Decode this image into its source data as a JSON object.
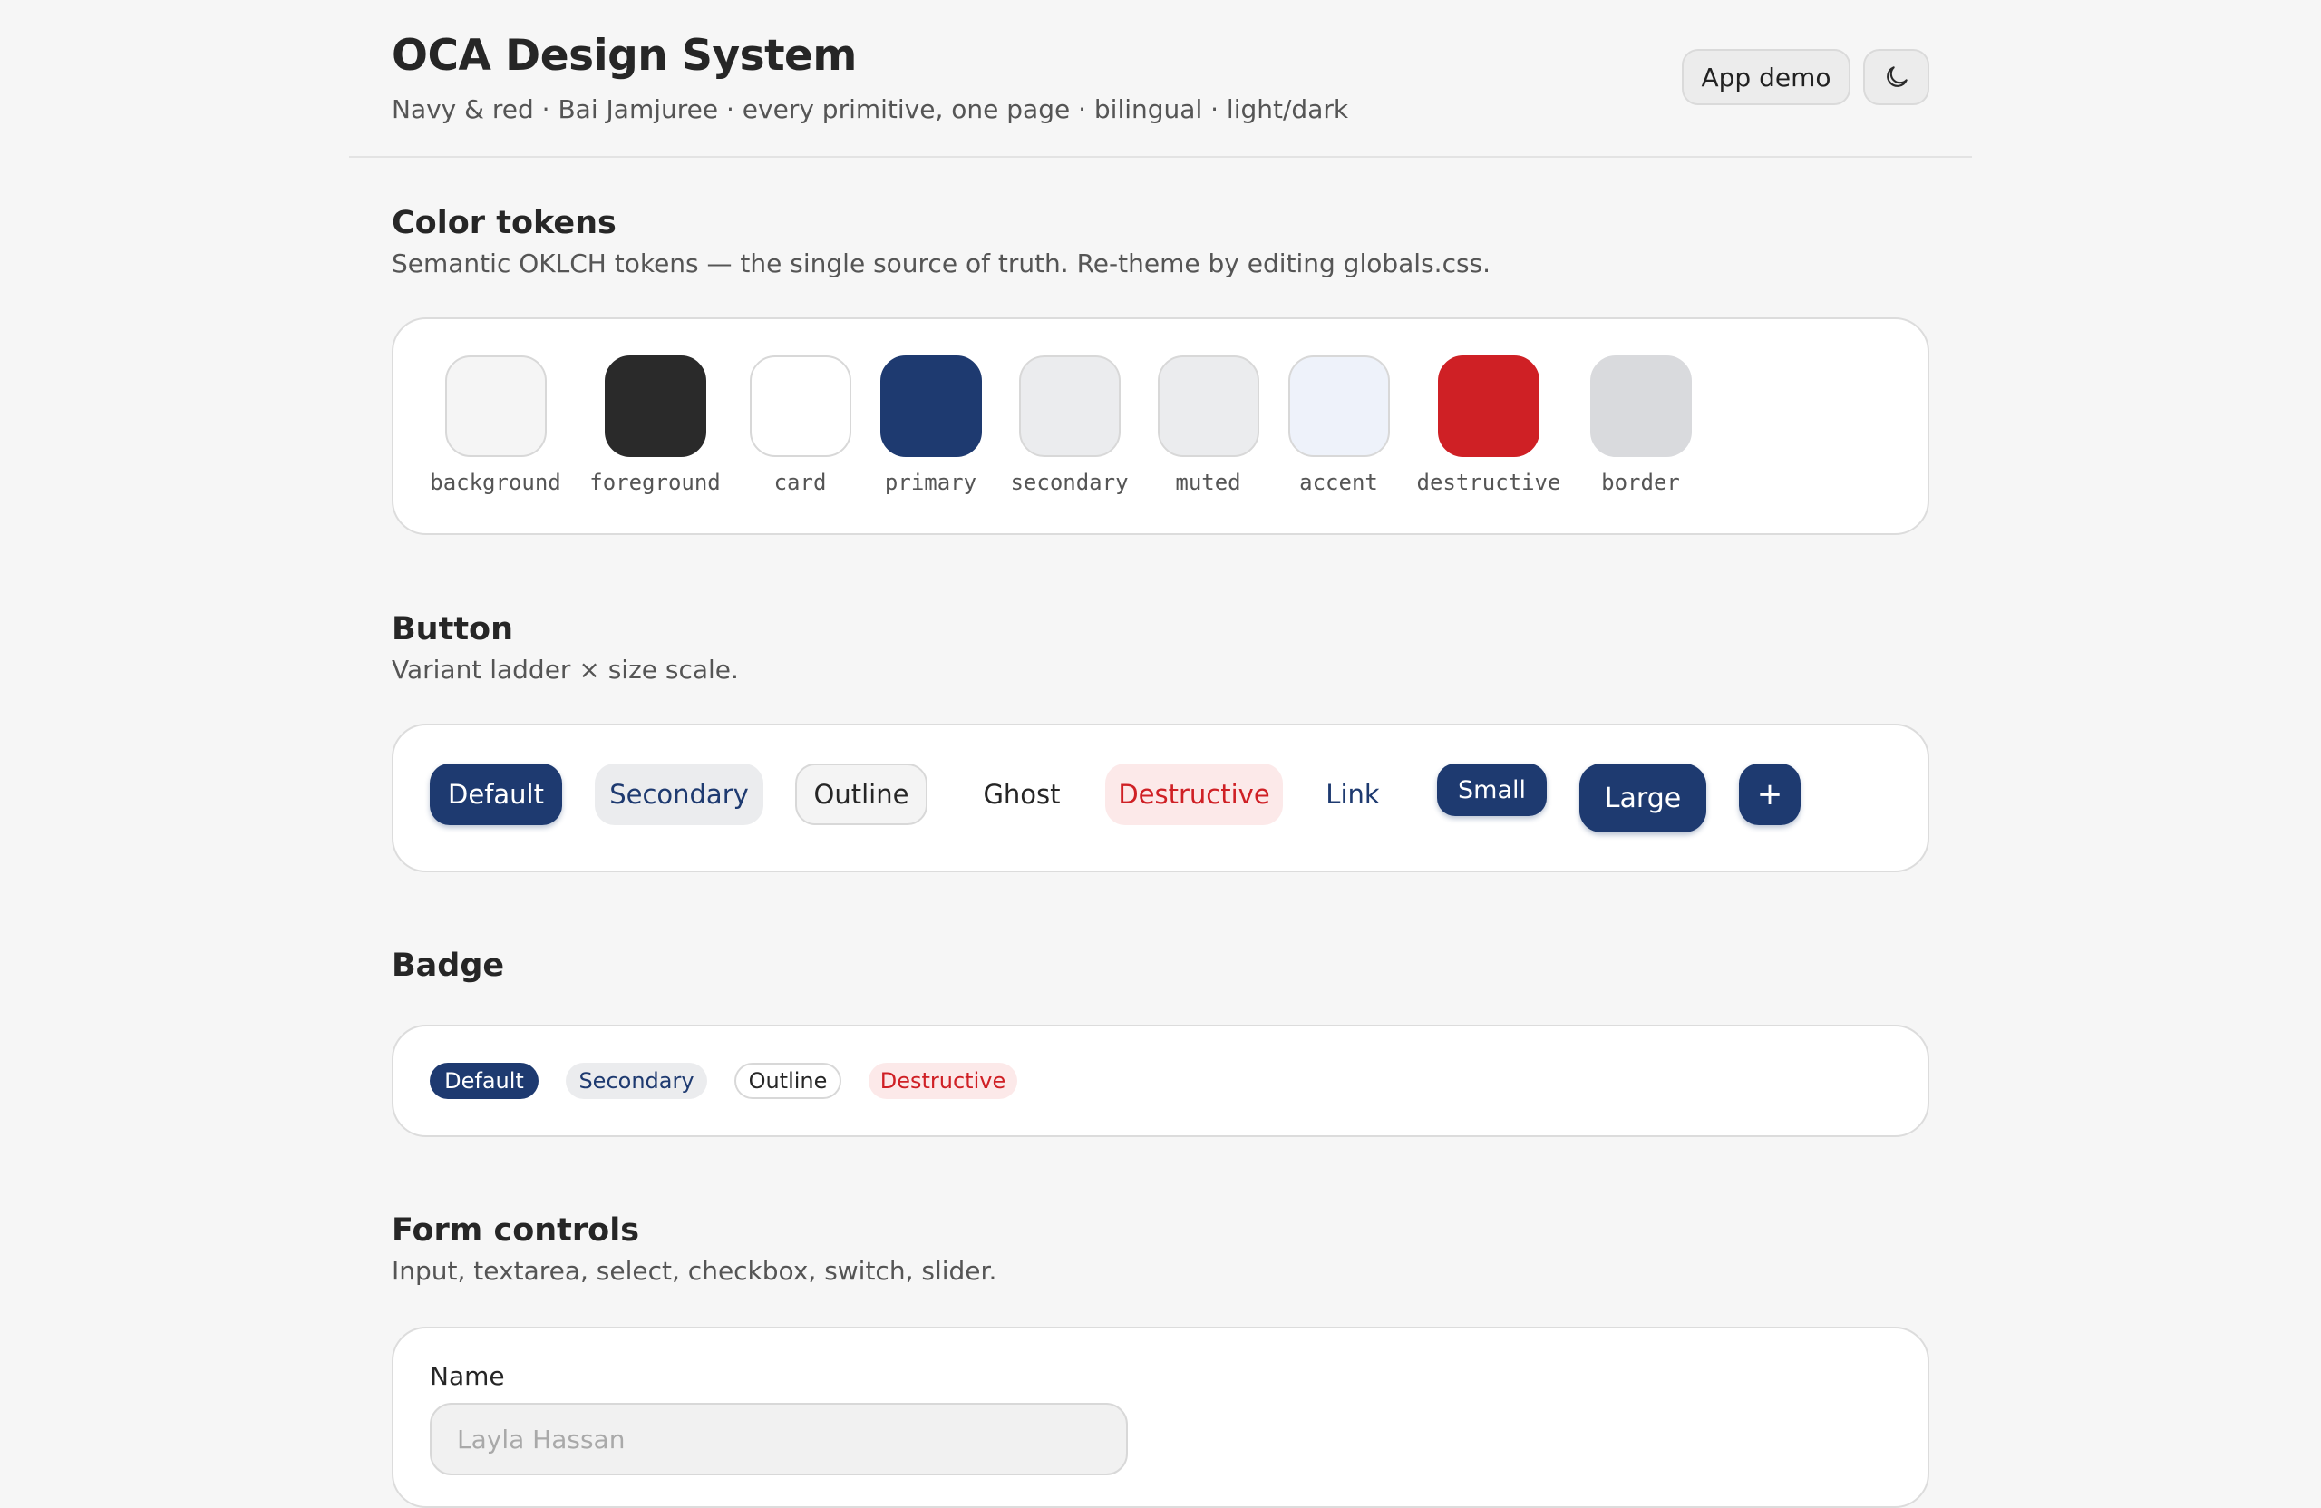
{
  "header": {
    "title": "OCA Design System",
    "subtitle": "Navy & red · Bai Jamjuree · every primitive, one page · bilingual · light/dark",
    "app_demo_label": "App demo",
    "theme_icon": "moon-icon"
  },
  "colors": {
    "primary": "#1e3a70",
    "destructive": "#cf2025",
    "foreground": "#2a2a2a",
    "background": "#f6f6f6"
  },
  "sections": {
    "color_tokens": {
      "title": "Color tokens",
      "desc": "Semantic OKLCH tokens — the single source of truth. Re-theme by editing globals.css.",
      "tokens": [
        {
          "label": "background",
          "color": "#f5f5f5"
        },
        {
          "label": "foreground",
          "color": "#2a2a2a"
        },
        {
          "label": "card",
          "color": "#ffffff"
        },
        {
          "label": "primary",
          "color": "#1e3a70"
        },
        {
          "label": "secondary",
          "color": "#ebecee"
        },
        {
          "label": "muted",
          "color": "#ebecee"
        },
        {
          "label": "accent",
          "color": "#eef2fa"
        },
        {
          "label": "destructive",
          "color": "#cf2025"
        },
        {
          "label": "border",
          "color": "#d9dadd"
        }
      ]
    },
    "button": {
      "title": "Button",
      "desc": "Variant ladder × size scale.",
      "buttons": {
        "default": "Default",
        "secondary": "Secondary",
        "outline": "Outline",
        "ghost": "Ghost",
        "destructive": "Destructive",
        "link": "Link",
        "small": "Small",
        "large": "Large",
        "icon": "+"
      }
    },
    "badge": {
      "title": "Badge",
      "badges": {
        "default": "Default",
        "secondary": "Secondary",
        "outline": "Outline",
        "destructive": "Destructive"
      }
    },
    "form_controls": {
      "title": "Form controls",
      "desc": "Input, textarea, select, checkbox, switch, slider.",
      "name_label": "Name",
      "name_placeholder": "Layla Hassan"
    }
  }
}
